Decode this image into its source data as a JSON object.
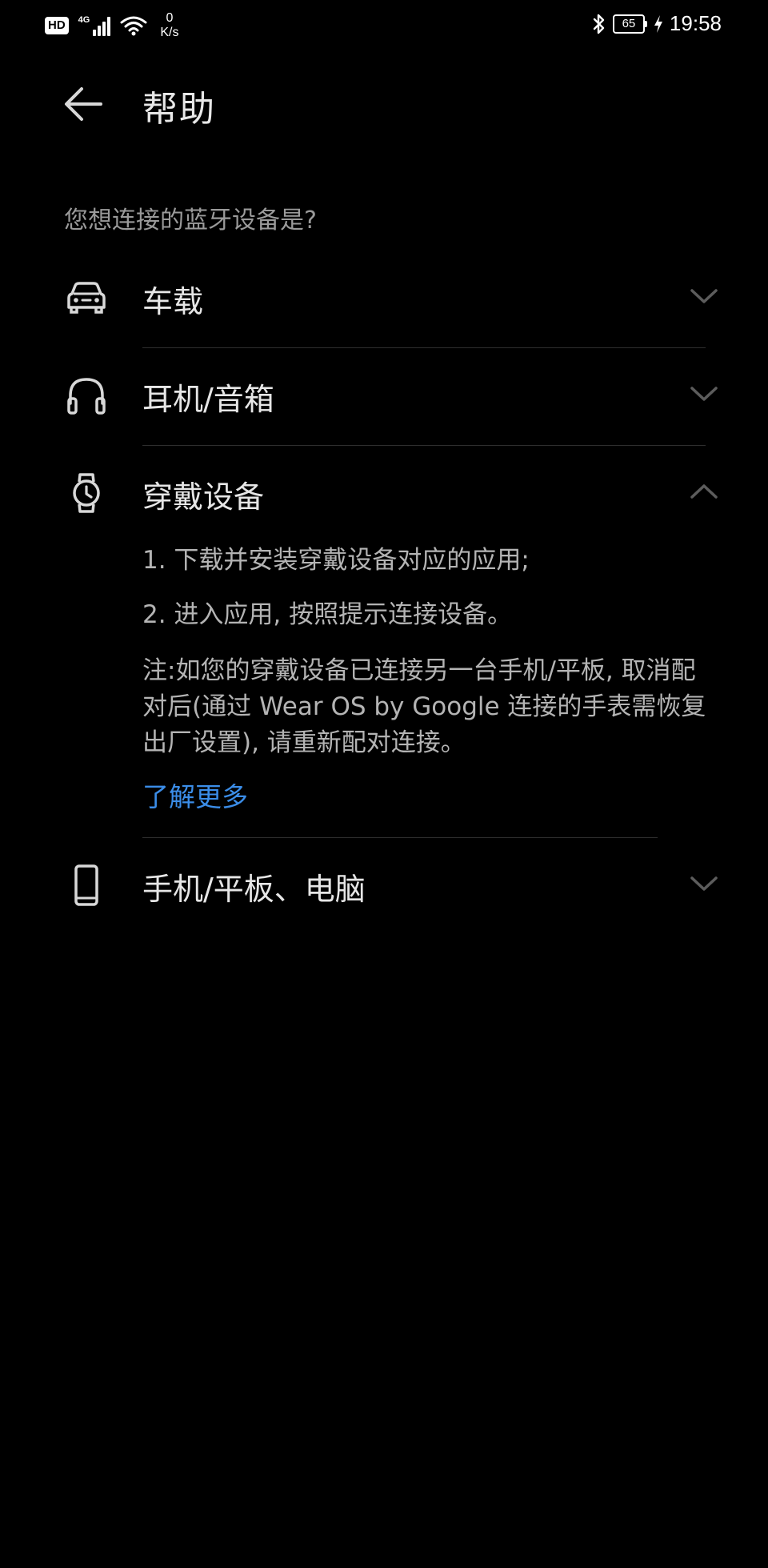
{
  "status_bar": {
    "hd": "HD",
    "network": "4G",
    "speed_value": "0",
    "speed_unit": "K/s",
    "battery": "65",
    "time": "19:58"
  },
  "appbar": {
    "title": "帮助"
  },
  "question": "您想连接的蓝牙设备是?",
  "items": [
    {
      "label": "车载",
      "icon": "car-icon",
      "expanded": false
    },
    {
      "label": "耳机/音箱",
      "icon": "headphones-icon",
      "expanded": false
    },
    {
      "label": "穿戴设备",
      "icon": "watch-icon",
      "expanded": true
    },
    {
      "label": "手机/平板、电脑",
      "icon": "phone-icon",
      "expanded": false
    }
  ],
  "wearable_detail": {
    "step1": "1. 下载并安装穿戴设备对应的应用;",
    "step2": "2. 进入应用, 按照提示连接设备。",
    "note": "注:如您的穿戴设备已连接另一台手机/平板, 取消配对后(通过 Wear OS by Google 连接的手表需恢复出厂设置), 请重新配对连接。",
    "learn_more": "了解更多"
  },
  "colors": {
    "background": "#000000",
    "link": "#3b8de8",
    "divider": "#2e2e2e"
  }
}
